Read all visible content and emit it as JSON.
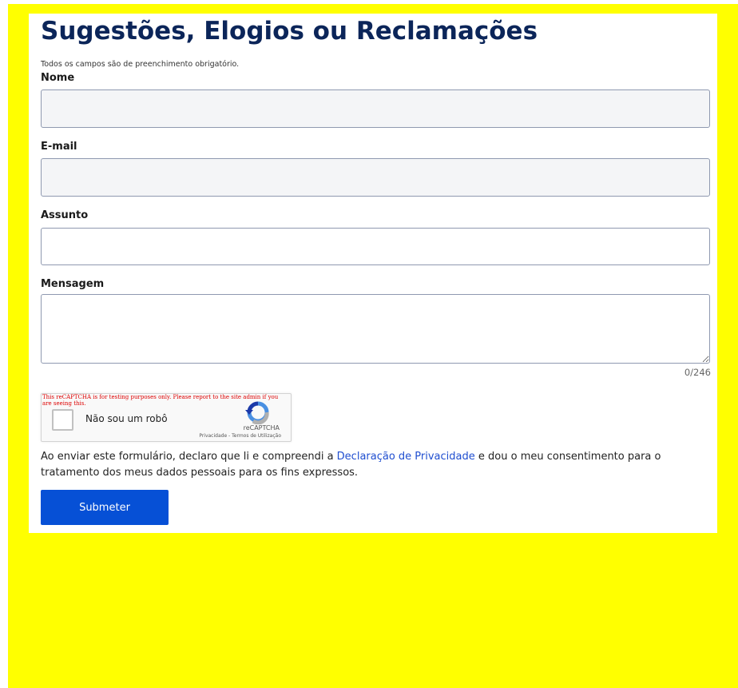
{
  "form": {
    "title": "Sugestões, Elogios ou Reclamações",
    "required_note": "Todos os campos são de preenchimento obrigatório.",
    "fields": {
      "name": {
        "label": "Nome",
        "value": ""
      },
      "email": {
        "label": "E-mail",
        "value": ""
      },
      "subject": {
        "label": "Assunto",
        "value": ""
      },
      "message": {
        "label": "Mensagem",
        "value": "",
        "counter": "0/246"
      }
    },
    "recaptcha": {
      "warning": "This reCAPTCHA is for testing purposes only. Please report to the site admin if you are seeing this.",
      "checkbox_label": "Não sou um robô",
      "brand": "reCAPTCHA",
      "links": "Privacidade - Termos de Utilização",
      "checked": false
    },
    "consent": {
      "before": "Ao enviar este formulário, declaro que li e compreendi a ",
      "link": "Declaração de Privacidade",
      "after": " e dou o meu consentimento para o tratamento dos meus dados pessoais para os fins expressos."
    },
    "submit_label": "Submeter"
  },
  "colors": {
    "page_background": "#ffff00",
    "title": "#0b2559",
    "primary_button": "#0650d6",
    "link": "#1f4ed0"
  }
}
